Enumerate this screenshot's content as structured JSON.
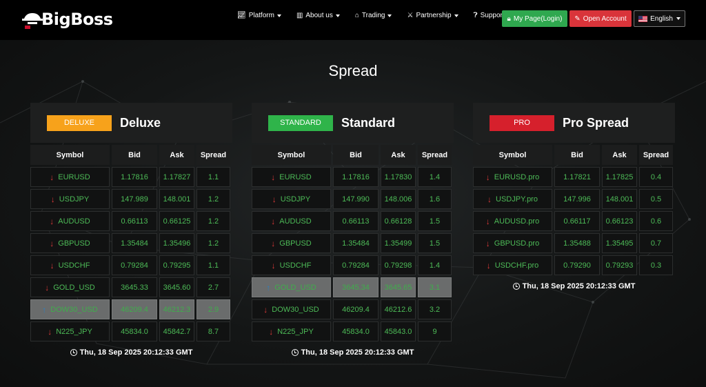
{
  "header": {
    "logo_text": "BigBoss",
    "nav": [
      {
        "label": "Platform",
        "icon": "chart-icon"
      },
      {
        "label": "About us",
        "icon": "building-icon"
      },
      {
        "label": "Trading",
        "icon": "bank-icon"
      },
      {
        "label": "Partnership",
        "icon": "handshake-icon"
      },
      {
        "label": "Support",
        "icon": "question-icon"
      }
    ],
    "login_label": "My Page(Login)",
    "open_account_label": "Open Account",
    "language_label": "English"
  },
  "page_title": "Spread",
  "columns": {
    "symbol": "Symbol",
    "bid": "Bid",
    "ask": "Ask",
    "spread": "Spread"
  },
  "colors": {
    "deluxe": "#f7a21b",
    "standard": "#2fb44a",
    "pro": "#d6202c",
    "green_text": "#4dbb57",
    "down_arrow": "#e03a3a",
    "up_arrow": "#2a7fc4"
  },
  "panels": [
    {
      "badge": "DELUXE",
      "title": "Deluxe",
      "timestamp": "Thu, 18 Sep 2025 20:12:33 GMT",
      "rows": [
        {
          "symbol": "EURUSD",
          "bid": "1.17816",
          "ask": "1.17827",
          "spread": "1.1",
          "dir": "down",
          "highlight": false
        },
        {
          "symbol": "USDJPY",
          "bid": "147.989",
          "ask": "148.001",
          "spread": "1.2",
          "dir": "down",
          "highlight": false
        },
        {
          "symbol": "AUDUSD",
          "bid": "0.66113",
          "ask": "0.66125",
          "spread": "1.2",
          "dir": "down",
          "highlight": false
        },
        {
          "symbol": "GBPUSD",
          "bid": "1.35484",
          "ask": "1.35496",
          "spread": "1.2",
          "dir": "down",
          "highlight": false
        },
        {
          "symbol": "USDCHF",
          "bid": "0.79284",
          "ask": "0.79295",
          "spread": "1.1",
          "dir": "down",
          "highlight": false
        },
        {
          "symbol": "GOLD_USD",
          "bid": "3645.33",
          "ask": "3645.60",
          "spread": "2.7",
          "dir": "down",
          "highlight": false
        },
        {
          "symbol": "DOW30_USD",
          "bid": "46209.4",
          "ask": "46212.3",
          "spread": "2.9",
          "dir": "up",
          "highlight": true
        },
        {
          "symbol": "N225_JPY",
          "bid": "45834.0",
          "ask": "45842.7",
          "spread": "8.7",
          "dir": "down",
          "highlight": false
        }
      ]
    },
    {
      "badge": "STANDARD",
      "title": "Standard",
      "timestamp": "Thu, 18 Sep 2025 20:12:33 GMT",
      "rows": [
        {
          "symbol": "EURUSD",
          "bid": "1.17816",
          "ask": "1.17830",
          "spread": "1.4",
          "dir": "down",
          "highlight": false
        },
        {
          "symbol": "USDJPY",
          "bid": "147.990",
          "ask": "148.006",
          "spread": "1.6",
          "dir": "down",
          "highlight": false
        },
        {
          "symbol": "AUDUSD",
          "bid": "0.66113",
          "ask": "0.66128",
          "spread": "1.5",
          "dir": "down",
          "highlight": false
        },
        {
          "symbol": "GBPUSD",
          "bid": "1.35484",
          "ask": "1.35499",
          "spread": "1.5",
          "dir": "down",
          "highlight": false
        },
        {
          "symbol": "USDCHF",
          "bid": "0.79284",
          "ask": "0.79298",
          "spread": "1.4",
          "dir": "down",
          "highlight": false
        },
        {
          "symbol": "GOLD_USD",
          "bid": "3645.34",
          "ask": "3645.65",
          "spread": "3.1",
          "dir": "up",
          "highlight": true
        },
        {
          "symbol": "DOW30_USD",
          "bid": "46209.4",
          "ask": "46212.6",
          "spread": "3.2",
          "dir": "down",
          "highlight": false
        },
        {
          "symbol": "N225_JPY",
          "bid": "45834.0",
          "ask": "45843.0",
          "spread": "9",
          "dir": "down",
          "highlight": false
        }
      ]
    },
    {
      "badge": "PRO",
      "title": "Pro Spread",
      "timestamp": "Thu, 18 Sep 2025 20:12:33 GMT",
      "rows": [
        {
          "symbol": "EURUSD.pro",
          "bid": "1.17821",
          "ask": "1.17825",
          "spread": "0.4",
          "dir": "down",
          "highlight": false
        },
        {
          "symbol": "USDJPY.pro",
          "bid": "147.996",
          "ask": "148.001",
          "spread": "0.5",
          "dir": "down",
          "highlight": false
        },
        {
          "symbol": "AUDUSD.pro",
          "bid": "0.66117",
          "ask": "0.66123",
          "spread": "0.6",
          "dir": "down",
          "highlight": false
        },
        {
          "symbol": "GBPUSD.pro",
          "bid": "1.35488",
          "ask": "1.35495",
          "spread": "0.7",
          "dir": "down",
          "highlight": false
        },
        {
          "symbol": "USDCHF.pro",
          "bid": "0.79290",
          "ask": "0.79293",
          "spread": "0.3",
          "dir": "down",
          "highlight": false
        }
      ]
    }
  ]
}
